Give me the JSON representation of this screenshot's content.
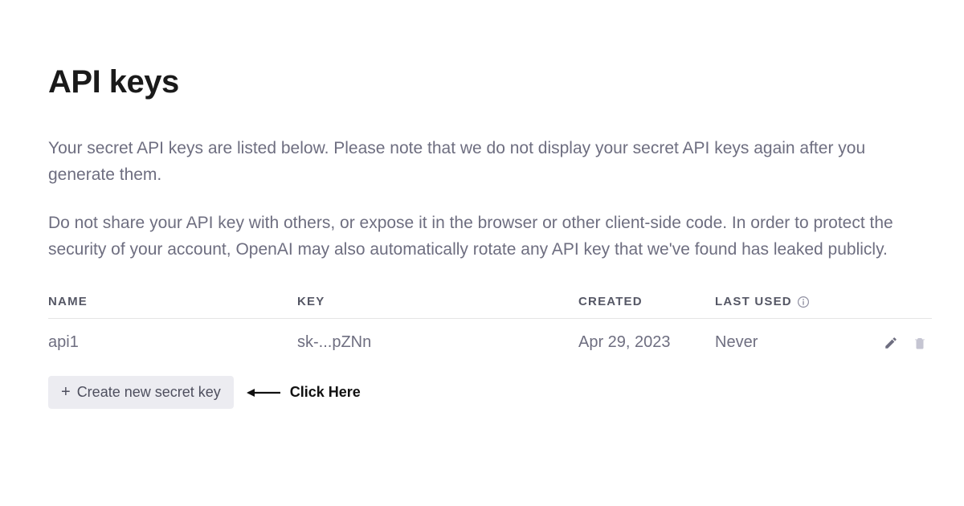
{
  "page": {
    "title": "API keys",
    "description1": "Your secret API keys are listed below. Please note that we do not display your secret API keys again after you generate them.",
    "description2": "Do not share your API key with others, or expose it in the browser or other client-side code. In order to protect the security of your account, OpenAI may also automatically rotate any API key that we've found has leaked publicly."
  },
  "table": {
    "headers": {
      "name": "NAME",
      "key": "KEY",
      "created": "CREATED",
      "last_used": "LAST USED"
    },
    "rows": [
      {
        "name": "api1",
        "key": "sk-...pZNn",
        "created": "Apr 29, 2023",
        "last_used": "Never"
      }
    ]
  },
  "actions": {
    "create_label": "Create new secret key"
  },
  "annotation": {
    "click_here": "Click Here"
  },
  "icons": {
    "info": "info-icon",
    "edit": "pencil-icon",
    "delete": "trash-icon",
    "plus": "plus-icon",
    "arrow": "arrow-left-icon"
  }
}
